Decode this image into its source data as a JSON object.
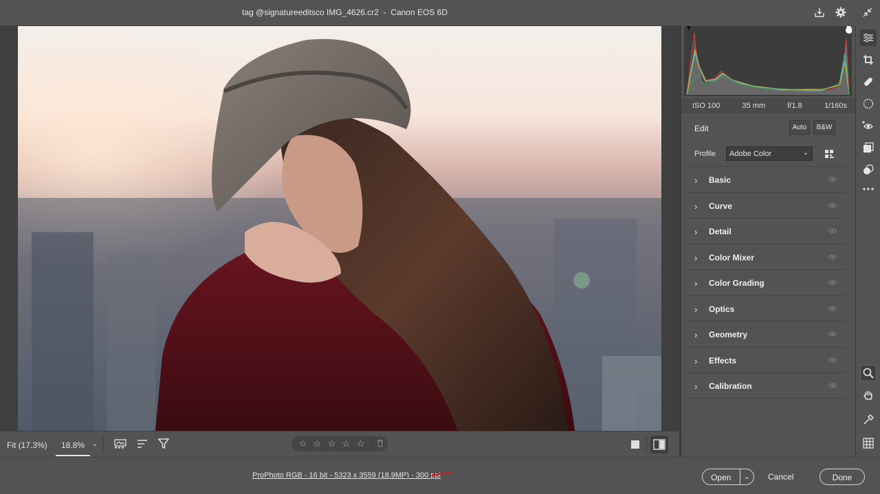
{
  "window": {
    "title": "tag @signatureeditsco IMG_4626.cr2  -  Canon EOS 6D"
  },
  "topbar": {
    "icons": [
      "save-download-icon",
      "settings-gear-icon",
      "collapse-icon"
    ]
  },
  "photo": {
    "description_icon": "portrait-photo"
  },
  "bottombar": {
    "zoom_fit": "Fit (17.3%)",
    "zoom_value": "18.8%",
    "rating_stars": 5,
    "icons": [
      "filmstrip-icon",
      "sort-icon",
      "filter-icon",
      "trash-icon",
      "view-single-icon",
      "before-after-icon"
    ]
  },
  "panel": {
    "exif": {
      "iso": "ISO 100",
      "focal": "35 mm",
      "aperture": "f/1.8",
      "shutter": "1/160s"
    },
    "edit": {
      "label": "Edit",
      "auto": "Auto",
      "bw": "B&W"
    },
    "profile": {
      "label": "Profile",
      "value": "Adobe Color"
    },
    "sections": [
      {
        "label": "Basic"
      },
      {
        "label": "Curve"
      },
      {
        "label": "Detail"
      },
      {
        "label": "Color Mixer"
      },
      {
        "label": "Color Grading"
      },
      {
        "label": "Optics"
      },
      {
        "label": "Geometry"
      },
      {
        "label": "Effects"
      },
      {
        "label": "Calibration"
      }
    ]
  },
  "toolstrip": {
    "tools": [
      "edit-sliders-icon",
      "crop-icon",
      "healing-icon",
      "masking-icon",
      "red-eye-icon",
      "snapshots-icon",
      "presets-icon",
      "more-icon",
      "zoom-icon",
      "hand-icon",
      "color-sampler-icon",
      "grid-icon"
    ]
  },
  "footer": {
    "info": "ProPhoto RGB - 16 bit - 5323 x 3559 (18.9MP) - 300 ppi",
    "open": "Open",
    "cancel": "Cancel",
    "done": "Done"
  },
  "colors": {
    "chrome": "#535353",
    "canvas": "#3f3f3f",
    "panel_border": "#3a3a3a",
    "accent_arrow": "#d01c1c"
  }
}
